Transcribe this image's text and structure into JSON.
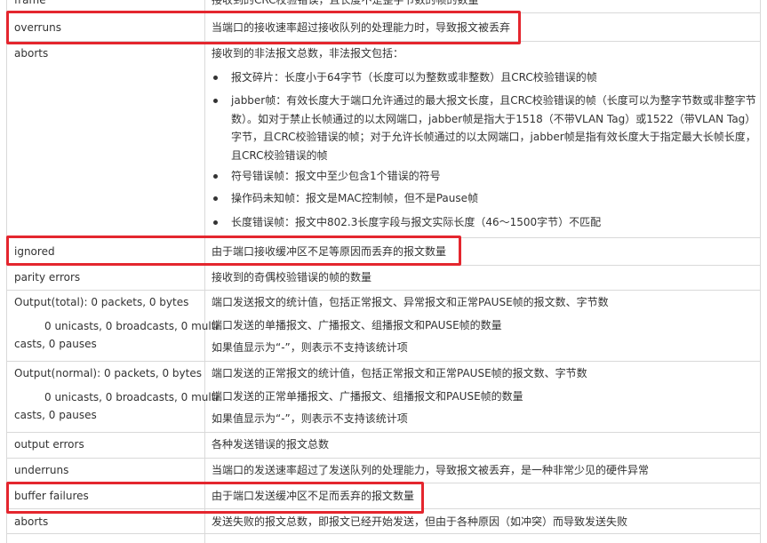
{
  "rows": [
    {
      "term": "frame",
      "desc": "接收到的CRC校验错误，且长度不是整字节数的帧的数量"
    },
    {
      "term": "overruns",
      "desc": "当端口的接收速率超过接收队列的处理能力时，导致报文被丢弃"
    },
    {
      "term": "aborts",
      "desc": "接收到的非法报文总数，非法报文包括：",
      "bullets": [
        "报文碎片：长度小于64字节（长度可以为整数或非整数）且CRC校验错误的帧",
        "jabber帧：有效长度大于端口允许通过的最大报文长度，且CRC校验错误的帧（长度可以为整字节数或非整字节数）。如对于禁止长帧通过的以太网端口，jabber帧是指大于1518（不带VLAN Tag）或1522（带VLAN Tag）字节，且CRC校验错误的帧；对于允许长帧通过的以太网端口，jabber帧是指有效长度大于指定最大长帧长度，且CRC校验错误的帧",
        "符号错误帧：报文中至少包含1个错误的符号",
        "操作码未知帧：报文是MAC控制帧，但不是Pause帧",
        "长度错误帧：报文中802.3长度字段与报文实际长度（46～1500字节）不匹配"
      ]
    },
    {
      "term": "ignored",
      "desc": "由于端口接收缓冲区不足等原因而丢弃的报文数量"
    },
    {
      "term": "parity errors",
      "desc": "接收到的奇偶校验错误的帧的数量"
    },
    {
      "term": "Output(total): 0 packets, 0 bytes",
      "term2": "0 unicasts, 0 broadcasts, 0 multi",
      "term3": "casts, 0 pauses",
      "desc": "端口发送报文的统计值，包括正常报文、异常报文和正常PAUSE帧的报文数、字节数",
      "desc2": "端口发送的单播报文、广播报文、组播报文和PAUSE帧的数量",
      "desc3": "如果值显示为“-”，则表示不支持该统计项"
    },
    {
      "term": "Output(normal): 0 packets, 0 bytes",
      "term2": "0 unicasts, 0 broadcasts, 0 multi",
      "term3": "casts, 0 pauses",
      "desc": "端口发送的正常报文的统计值，包括正常报文和正常PAUSE帧的报文数、字节数",
      "desc2": "端口发送的正常单播报文、广播报文、组播报文和PAUSE帧的数量",
      "desc3": "如果值显示为“-”，则表示不支持该统计项"
    },
    {
      "term": "output errors",
      "desc": "各种发送错误的报文总数"
    },
    {
      "term": "underruns",
      "desc": "当端口的发送速率超过了发送队列的处理能力，导致报文被丢弃，是一种非常少见的硬件异常"
    },
    {
      "term": "buffer failures",
      "desc": "由于端口发送缓冲区不足而丢弃的报文数量"
    },
    {
      "term": "aborts",
      "desc": "发送失败的报文总数，即报文已经开始发送，但由于各种原因（如冲突）而导致发送失败"
    }
  ],
  "highlight_color": "#e4262e"
}
